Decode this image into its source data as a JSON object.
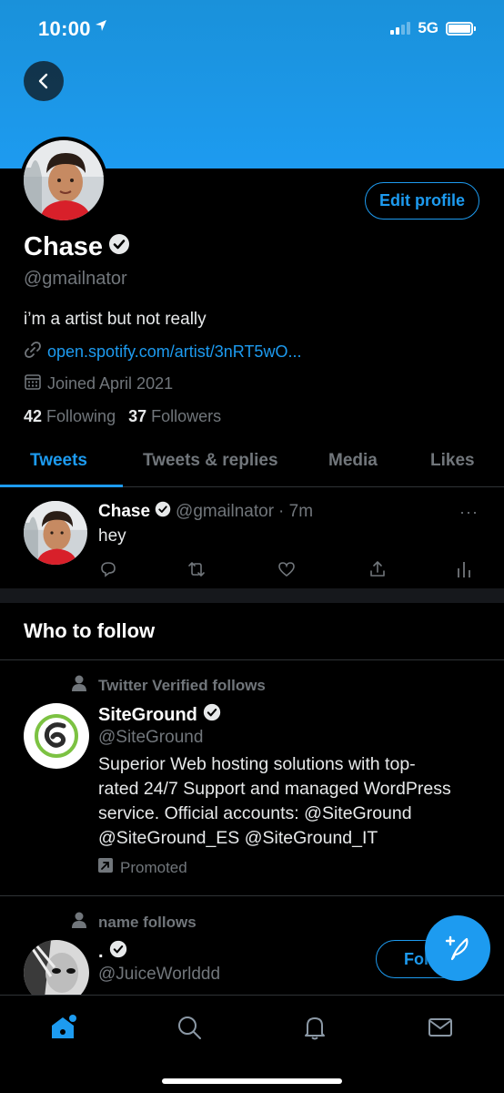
{
  "status_bar": {
    "time": "10:00",
    "network": "5G",
    "battery_level": 1.0,
    "signal_bars": 2,
    "signal_bars_total": 4
  },
  "colors": {
    "accent": "#1d9bf0",
    "banner": "#1d9bf0",
    "background": "#000000",
    "secondary_text": "#71767b"
  },
  "profile": {
    "name": "Chase",
    "handle": "@gmailnator",
    "bio": "i’m a artist but not really",
    "link": "open.spotify.com/artist/3nRT5wO...",
    "joined": "Joined April 2021",
    "following_count": "42",
    "following_label": "Following",
    "followers_count": "37",
    "followers_label": "Followers",
    "edit_label": "Edit profile",
    "verified": true
  },
  "tabs": [
    {
      "label": "Tweets",
      "active": true
    },
    {
      "label": "Tweets & replies",
      "active": false
    },
    {
      "label": "Media",
      "active": false
    },
    {
      "label": "Likes",
      "active": false
    }
  ],
  "tweet": {
    "name": "Chase",
    "handle": "@gmailnator",
    "time": "· 7m",
    "text": "hey",
    "more": "···"
  },
  "who_to_follow": {
    "title": "Who to follow",
    "items": [
      {
        "context": "Twitter Verified follows",
        "name": "SiteGround",
        "handle": "@SiteGround",
        "bio_lines": [
          "Superior Web hosting solutions with top-",
          "rated 24/7 Support and managed WordPress",
          "service. Official accounts: @SiteGround",
          "@SiteGround_ES @SiteGround_IT"
        ],
        "promoted": "Promoted"
      },
      {
        "context": "name follows",
        "name": ".",
        "handle": "@JuiceWorlddd",
        "follow_label": "Fol"
      }
    ]
  },
  "icons": {
    "back": "arrow-left-icon",
    "location": "location-arrow-icon",
    "link": "link-icon",
    "calendar": "calendar-icon",
    "verified": "verified-badge-icon",
    "reply": "reply-icon",
    "retweet": "retweet-icon",
    "like": "heart-icon",
    "share": "share-icon",
    "analytics": "analytics-icon",
    "person": "person-icon",
    "promoted": "promoted-icon",
    "compose": "compose-icon",
    "home": "home-icon",
    "search": "search-icon",
    "notifications": "bell-icon",
    "messages": "mail-icon"
  }
}
